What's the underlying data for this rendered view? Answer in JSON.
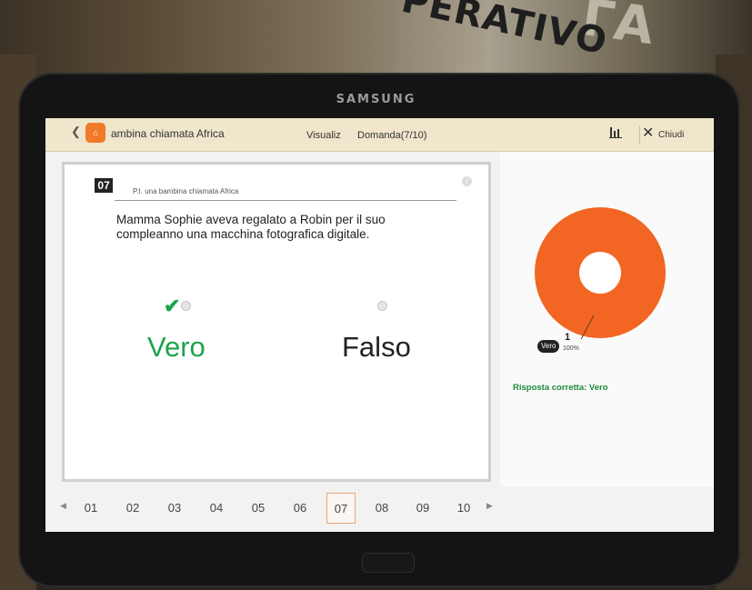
{
  "background": {
    "poster_text": "PERATIVO",
    "poster_text_2": "ΓΑ"
  },
  "device": {
    "brand": "SAMSUNG"
  },
  "titlebar": {
    "app_title": "ambina chiamata Africa",
    "menu_visualiz": "Visualiz",
    "menu_domanda": "Domanda(7/10)",
    "close_label": "Chiudi"
  },
  "question": {
    "number": "07",
    "source": "P.I. una  bambina  chiamata Africa",
    "text": "Mamma Sophie  aveva regalato a Robin per il suo compleanno una macchina fotografica digitale.",
    "answers": {
      "vero": "Vero",
      "falso": "Falso"
    }
  },
  "results": {
    "chart_legend_label": "Vero",
    "count": "1",
    "percent": "100%",
    "correct_answer": "Risposta corretta: Vero",
    "colors": {
      "slice": "#f26522",
      "check": "#1fa34a"
    }
  },
  "pager": {
    "items": [
      "01",
      "02",
      "03",
      "04",
      "05",
      "06",
      "07",
      "08",
      "09",
      "10"
    ],
    "active": "07"
  }
}
